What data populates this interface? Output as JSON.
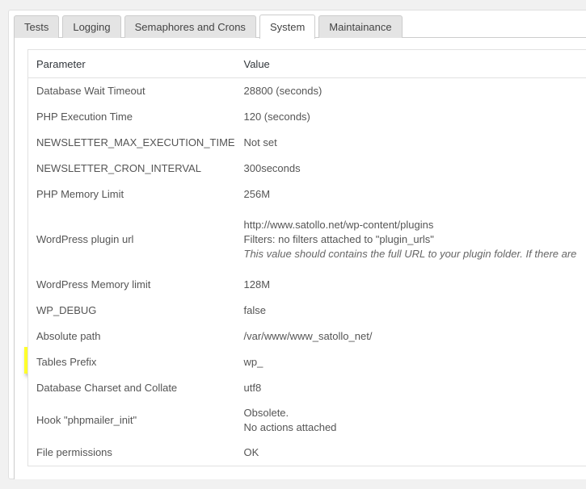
{
  "tabs": [
    {
      "label": "Tests",
      "active": false
    },
    {
      "label": "Logging",
      "active": false
    },
    {
      "label": "Semaphores and Crons",
      "active": false
    },
    {
      "label": "System",
      "active": true
    },
    {
      "label": "Maintainance",
      "active": false
    }
  ],
  "table": {
    "headers": {
      "parameter": "Parameter",
      "value": "Value"
    },
    "rows": [
      {
        "parameter": "Database Wait Timeout",
        "value": "28800 (seconds)"
      },
      {
        "parameter": "PHP Execution Time",
        "value": "120 (seconds)"
      },
      {
        "parameter": "NEWSLETTER_MAX_EXECUTION_TIME",
        "value": "Not set"
      },
      {
        "parameter": "NEWSLETTER_CRON_INTERVAL",
        "value": "300seconds"
      },
      {
        "parameter": "PHP Memory Limit",
        "value": "256M"
      },
      {
        "parameter": "WordPress plugin url",
        "value": "http://www.satollo.net/wp-content/plugins",
        "value_line2": "Filters: no filters attached to \"plugin_urls\"",
        "note": "This value should contains the full URL to your plugin folder. If there are"
      },
      {
        "parameter": "WordPress Memory limit",
        "value": "128M"
      },
      {
        "parameter": "WP_DEBUG",
        "value": "false"
      },
      {
        "parameter": "Absolute path",
        "value": "/var/www/www_satollo_net/"
      },
      {
        "parameter": "Tables Prefix",
        "value": "wp_",
        "highlighted": true
      },
      {
        "parameter": "Database Charset and Collate",
        "value": "utf8"
      },
      {
        "parameter": "Hook \"phpmailer_init\"",
        "value": "Obsolete.",
        "value_line2": "No actions attached"
      },
      {
        "parameter": "File permissions",
        "value": "OK"
      }
    ]
  },
  "colors": {
    "highlight": "#ffff2a",
    "background": "#f1f1f1",
    "border": "#e1e1e1"
  }
}
